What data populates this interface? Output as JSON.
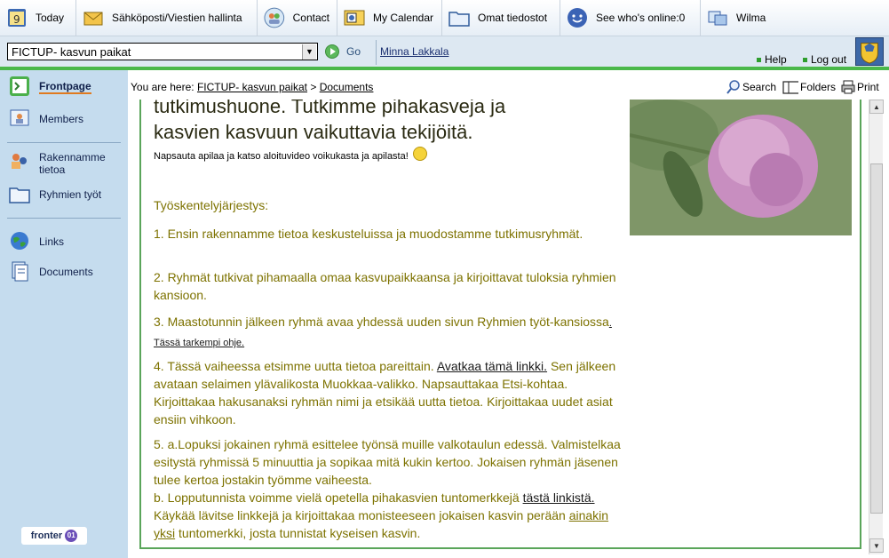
{
  "topbar": {
    "items": [
      {
        "label": "Today",
        "icon": "calendar-day-icon"
      },
      {
        "label": "Sähköposti/Viestien hallinta",
        "icon": "mail-icon"
      },
      {
        "label": "Contact",
        "icon": "contact-icon"
      },
      {
        "label": "My Calendar",
        "icon": "calendar-icon"
      },
      {
        "label": "Omat tiedostot",
        "icon": "folder-icon"
      },
      {
        "label": "See who's online:0",
        "icon": "smiley-icon"
      },
      {
        "label": "Wilma",
        "icon": "wilma-icon"
      }
    ]
  },
  "secondbar": {
    "group_selected": "FICTUP- kasvun paikat",
    "go_label": "Go",
    "user_name": "Minna Lakkala",
    "help_label": "Help",
    "logout_label": "Log out"
  },
  "sidebar": {
    "items": [
      {
        "label": "Frontpage",
        "icon": "frontpage-icon"
      },
      {
        "label": "Members",
        "icon": "members-icon"
      },
      {
        "label": "Rakennamme tietoa",
        "icon": "people-icon"
      },
      {
        "label": "Ryhmien työt",
        "icon": "folder-icon"
      },
      {
        "label": "Links",
        "icon": "globe-icon"
      },
      {
        "label": "Documents",
        "icon": "documents-icon"
      }
    ],
    "logo_text": "fronter",
    "logo_badge": "01"
  },
  "breadcrumb": {
    "prefix": "You are here:",
    "items": [
      "FICTUP- kasvun paikat",
      "Documents"
    ],
    "separator": ">"
  },
  "tools": {
    "search": "Search",
    "folders": "Folders",
    "print": "Print"
  },
  "content": {
    "heading_line1": "tutkimushuone. Tutkimme pihakasveja ja",
    "heading_line2": "kasvien kasvuun vaikuttavia tekijöitä.",
    "intro": "Napsauta apilaa ja katso aloituvideo voikukasta ja apilasta!",
    "order_title": "Työskentelyjärjestys:",
    "p1": "1. Ensin rakennamme tietoa keskusteluissa ja muodostamme tutkimusryhmät.",
    "p2": "2. Ryhmät tutkivat pihamaalla omaa kasvupaikkaansa ja kirjoittavat tuloksia ryhmien kansioon.",
    "p3a": "3. Maastotunnin jälkeen ryhmä avaa yhdessä uuden sivun Ryhmien työt-kansiossa",
    "p3_link": ". Tässä tarkempi ohje.",
    "p4a": "4. Tässä vaiheessa etsimme uutta tietoa pareittain. ",
    "p4_link": "Avatkaa tämä linkki.",
    "p4b": " Sen jälkeen avataan selaimen ylävalikosta Muokkaa-valikko. Napsauttakaa Etsi-kohtaa. Kirjoittakaa hakusanaksi ryhmän nimi ja etsikää uutta tietoa. Kirjoittakaa uudet asiat ensiin vihkoon.",
    "p5a": "5. a.Lopuksi jokainen ryhmä esittelee työnsä muille valkotaulun edessä. Valmistelkaa esitystä ryhmissä 5 minuuttia ja sopikaa mitä kukin kertoo. Jokaisen ryhmän jäsenen tulee kertoa jostakin työmme vaiheesta.",
    "p5b": "b. Lopputunnista voimme vielä opetella pihakasvien tuntomerkkejä ",
    "p5_link1": "tästä linkistä.",
    "p5c": " Käykää lävitse linkkejä ja kirjoittakaa monisteeseen jokaisen kasvin perään ",
    "p5_link2": "ainakin yksi",
    "p5d": " tuntomerkki, josta tunnistat kyseisen kasvin."
  }
}
